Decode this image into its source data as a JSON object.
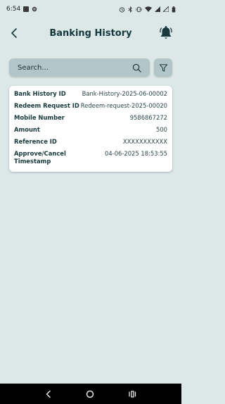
{
  "status_bar": {
    "time": "6:54",
    "icons": [
      "app-square-icon",
      "settings-gear-icon",
      "alarm-icon",
      "bluetooth-icon",
      "vibrate-icon",
      "wifi-icon",
      "signal-icon",
      "signal-icon",
      "battery-icon"
    ]
  },
  "header": {
    "title": "Banking History",
    "back_icon": "back-arrow-icon",
    "bell_icon": "notification-bell-icon"
  },
  "search": {
    "placeholder": "Search...",
    "filter_icon": "filter-funnel-icon"
  },
  "records": [
    {
      "fields": [
        {
          "label": "Bank History ID",
          "value": "Bank-History-2025-06-00002"
        },
        {
          "label": "Redeem Request ID",
          "value": "Redeem-request-2025-00020"
        },
        {
          "label": "Mobile Number",
          "value": "9586867272"
        },
        {
          "label": "Amount",
          "value": "500"
        },
        {
          "label": "Reference ID",
          "value": "XXXXXXXXXXX"
        },
        {
          "label": "Approve/Cancel Timestamp",
          "value": "04-06-2025 18:53:55"
        }
      ]
    }
  ],
  "colors": {
    "background": "#dce7e8",
    "accent": "#17393c",
    "search_bg": "#b2c5c8",
    "card_bg": "#ffffff"
  },
  "nav": {
    "back": "nav-back-icon",
    "home": "nav-home-icon",
    "recents": "nav-recents-icon"
  }
}
